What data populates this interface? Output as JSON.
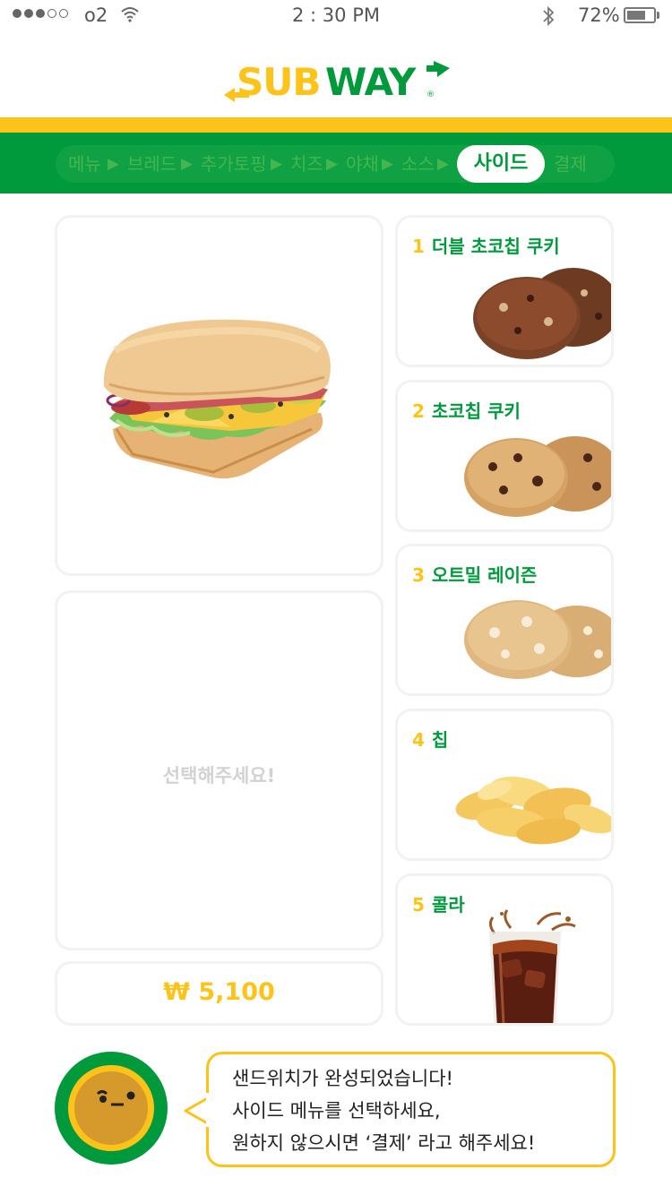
{
  "status_bar": {
    "carrier": "o2",
    "time": "2 : 30 PM",
    "battery": "72%",
    "battery_level": 0.72,
    "signal_strength": 3
  },
  "brand": {
    "name": "SUBWAY",
    "trademark": "®",
    "yellow": "#fdc318",
    "green": "#009a3c"
  },
  "steps": {
    "items": [
      "메뉴",
      "브레드",
      "추가토핑",
      "치즈",
      "야채",
      "소스",
      "사이드",
      "결제"
    ],
    "active": "사이드",
    "separator": "▶"
  },
  "preview": {
    "image": "sandwich-image",
    "placeholder": "선택해주세요!",
    "price": "₩ 5,100"
  },
  "sides": [
    {
      "number": "1",
      "name": "더블 초코칩 쿠키",
      "image": "double-choco-cookie-image"
    },
    {
      "number": "2",
      "name": "초코칩 쿠키",
      "image": "choco-chip-cookie-image"
    },
    {
      "number": "3",
      "name": "오트밀 레이즌",
      "image": "oatmeal-raisin-cookie-image"
    },
    {
      "number": "4",
      "name": "칩",
      "image": "chips-image"
    },
    {
      "number": "5",
      "name": "콜라",
      "image": "cola-image"
    }
  ],
  "assistant": {
    "icon": "mascot-icon",
    "lines": [
      "샌드위치가 완성되었습니다!",
      "사이드 메뉴를 선택하세요,",
      "원하지 않으시면 ‘결제’ 라고 해주세요!"
    ]
  }
}
